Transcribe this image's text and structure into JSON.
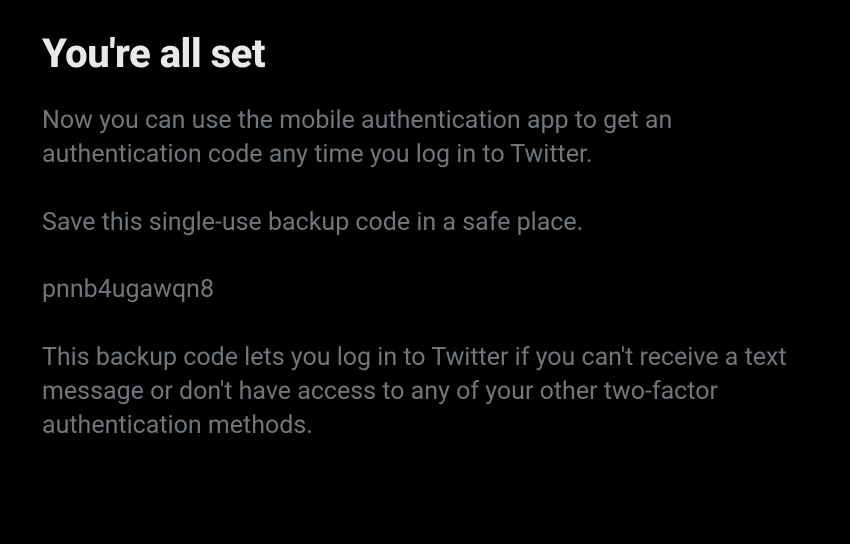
{
  "heading": "You're all set",
  "paragraph1": "Now you can use the mobile authentication app to get an authentication code any time you log in to Twitter.",
  "paragraph2": "Save this single-use backup code in a safe place.",
  "backup_code": "pnnb4ugawqn8",
  "paragraph3": "This backup code lets you log in to Twitter if you can't receive a text message or don't have access to any of your other two-factor authentication methods."
}
